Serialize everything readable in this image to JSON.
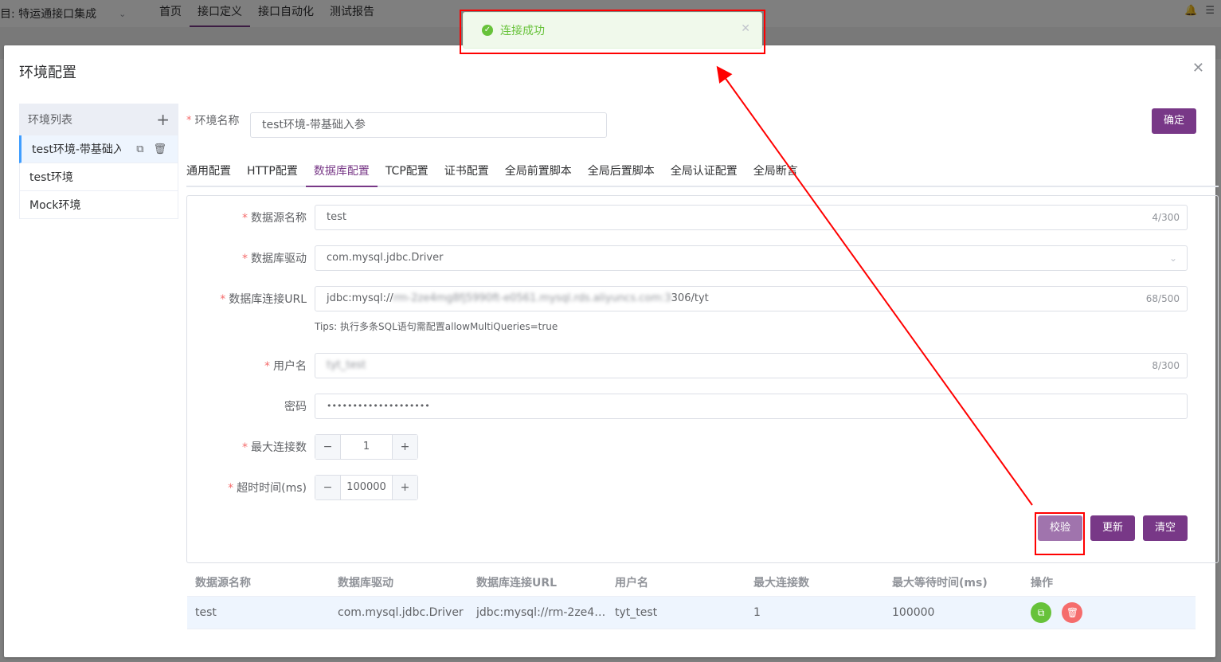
{
  "app": {
    "project_label": "目: 特运通接口集成",
    "nav": [
      "首页",
      "接口定义",
      "接口自动化",
      "测试报告"
    ]
  },
  "dialog": {
    "title": "环境配置",
    "env_list": {
      "header": "环境列表",
      "items": [
        "test环境-带基础入参",
        "test环境",
        "Mock环境"
      ]
    },
    "env_name_label": "环境名称",
    "env_name_value": "test环境-带基础入参",
    "confirm_label": "确定",
    "tabs": [
      "通用配置",
      "HTTP配置",
      "数据库配置",
      "TCP配置",
      "证书配置",
      "全局前置脚本",
      "全局后置脚本",
      "全局认证配置",
      "全局断言"
    ],
    "active_tab": "数据库配置",
    "db_form": {
      "datasource_label": "数据源名称",
      "datasource_value": "test",
      "datasource_count": "4/300",
      "driver_label": "数据库驱动",
      "driver_value": "com.mysql.jdbc.Driver",
      "url_label": "数据库连接URL",
      "url_prefix": "jdbc:mysql://",
      "url_masked": "rm-2ze4mg8fj5990ft-e0561.mysql.rds.aliyuncs.com:3",
      "url_suffix": "306/tyt",
      "url_count": "68/500",
      "tips": "Tips: 执行多条SQL语句需配置allowMultiQueries=true",
      "username_label": "用户名",
      "username_masked": "tyt_test",
      "username_count": "8/300",
      "password_label": "密码",
      "password_value": "••••••••••••••••••••",
      "max_conn_label": "最大连接数",
      "max_conn_value": "1",
      "timeout_label": "超时时间(ms)",
      "timeout_value": "100000",
      "verify_label": "校验",
      "update_label": "更新",
      "clear_label": "清空"
    },
    "table": {
      "headers": [
        "数据源名称",
        "数据库驱动",
        "数据库连接URL",
        "用户名",
        "最大连接数",
        "最大等待时间(ms)",
        "操作"
      ],
      "rows": [
        [
          "test",
          "com.mysql.jdbc.Driver",
          "jdbc:mysql://rm-2ze4…",
          "tyt_test",
          "1",
          "100000"
        ]
      ]
    }
  },
  "toast": {
    "message": "连接成功",
    "type": "success"
  },
  "colors": {
    "primary": "#783887",
    "success": "#67c23a",
    "danger": "#f56c6c",
    "annotation": "#ff0000"
  }
}
